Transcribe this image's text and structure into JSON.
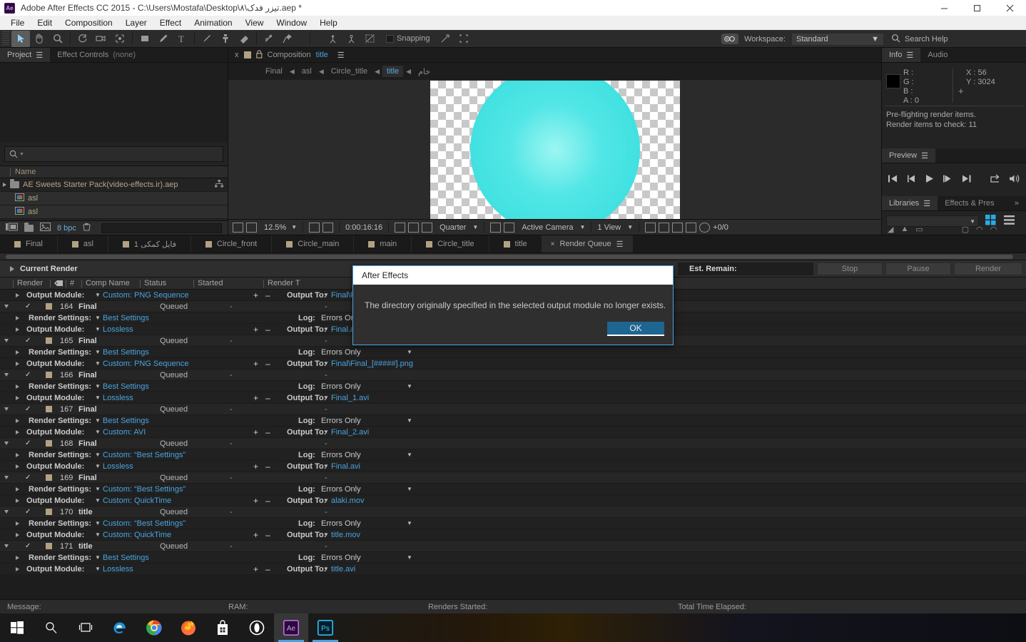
{
  "window": {
    "title": "Adobe After Effects CC 2015 - C:\\Users\\Mostafa\\Desktop\\۸\\تیزر فدک.aep *",
    "app_icon": "Ae",
    "minimize": "minimize-icon",
    "maximize": "maximize-icon",
    "close": "close-icon"
  },
  "menu": [
    "File",
    "Edit",
    "Composition",
    "Layer",
    "Effect",
    "Animation",
    "View",
    "Window",
    "Help"
  ],
  "toolbar": {
    "tools": [
      "selection-tool",
      "hand-tool",
      "zoom-tool",
      "rotation-tool",
      "camera-tool",
      "pan-behind-tool",
      "shape-tool",
      "pen-tool",
      "type-tool",
      "brush-tool",
      "clone-stamp-tool",
      "eraser-tool",
      "roto-brush-tool",
      "puppet-pin-tool"
    ],
    "right_tools": [
      "local-axis-mode",
      "world-axis-mode",
      "view-axis-mode"
    ],
    "snapping_label": "Snapping",
    "snap_tools": [
      "snap-to-feature",
      "align-to-bounds"
    ],
    "workspace_label": "Workspace:",
    "workspace_value": "Standard",
    "search_placeholder": "Search Help"
  },
  "project_panel": {
    "tabs": [
      {
        "label": "Project",
        "active": true,
        "suffix": ""
      },
      {
        "label": "Effect Controls",
        "active": false,
        "suffix": "(none)"
      }
    ],
    "search_placeholder": "",
    "column_header": "Name",
    "rows": [
      {
        "name": "AE Sweets Starter Pack(video-effects.ir).aep",
        "type": "folder",
        "expander": true
      },
      {
        "name": "asl",
        "type": "comp",
        "expander": false
      },
      {
        "name": "asl",
        "type": "comp",
        "expander": false
      }
    ],
    "footer": {
      "bit_depth": "8 bpc",
      "icons": [
        "new-comp-icon",
        "new-folder-icon",
        "new-footage-icon",
        "delete-icon"
      ]
    }
  },
  "comp_panel": {
    "close": "x",
    "label": "Composition",
    "name": "title",
    "lock_icon": "lock-icon",
    "menu_icon": "panel-menu-icon",
    "breadcrumb": [
      {
        "label": "Final",
        "active": false
      },
      {
        "label": "asl",
        "active": false
      },
      {
        "label": "Circle_title",
        "active": false
      },
      {
        "label": "title",
        "active": true
      },
      {
        "label": "خام",
        "active": false
      }
    ],
    "footer": {
      "zoom": "12.5%",
      "time": "0:00:16:16",
      "resolution": "Quarter",
      "camera": "Active Camera",
      "views": "1 View",
      "frame_offset": "+0/0",
      "icons": [
        "toggle-transparency-grid-icon",
        "toggle-viewer-icon",
        "region-of-interest-icon",
        "title-action-safe-icon",
        "take-snapshot-icon",
        "show-snapshot-icon",
        "show-channel-icon",
        "toggle-mask-icon",
        "toggle-transparency-icon",
        "timeline-icon",
        "fast-previews-icon",
        "render-stats-icon",
        "3d-renderer-icon",
        "reset-exposure-icon"
      ]
    }
  },
  "info_panel": {
    "tabs": [
      {
        "label": "Info",
        "active": true
      },
      {
        "label": "Audio",
        "active": false
      }
    ],
    "color": {
      "R": "R :",
      "G": "G :",
      "B": "B :",
      "A": "A : 0"
    },
    "coords": {
      "X": "X : 56",
      "Y": "Y : 3024"
    },
    "message_line1": "Pre-flighting render items.",
    "message_line2": "Render items to check: 11"
  },
  "preview_panel": {
    "tabs": [
      {
        "label": "Preview",
        "active": true
      }
    ],
    "buttons": [
      "first-frame-icon",
      "previous-frame-icon",
      "play-icon",
      "next-frame-icon",
      "last-frame-icon",
      "loop-icon",
      "mute-audio-icon"
    ]
  },
  "libraries_panel": {
    "tabs": [
      {
        "label": "Libraries",
        "active": true
      },
      {
        "label": "Effects & Pres",
        "active": false
      }
    ],
    "overflow": "»",
    "view_icons": [
      "grid-view-icon",
      "list-view-icon"
    ]
  },
  "comp_tabs": [
    {
      "label": "Final",
      "active": false,
      "closable": false
    },
    {
      "label": "asl",
      "active": false,
      "closable": false
    },
    {
      "label": "فایل کمکی 1",
      "active": false,
      "closable": false
    },
    {
      "label": "Circle_front",
      "active": false,
      "closable": false
    },
    {
      "label": "Circle_main",
      "active": false,
      "closable": false
    },
    {
      "label": "main",
      "active": false,
      "closable": false
    },
    {
      "label": "Circle_title",
      "active": false,
      "closable": false
    },
    {
      "label": "title",
      "active": false,
      "closable": false
    },
    {
      "label": "Render Queue",
      "active": true,
      "closable": true
    }
  ],
  "render_queue": {
    "current_render_label": "Current Render",
    "est_remain_label": "Est. Remain:",
    "buttons": [
      {
        "label": "Stop",
        "name": "stop-button"
      },
      {
        "label": "Pause",
        "name": "pause-button"
      },
      {
        "label": "Render",
        "name": "render-button"
      }
    ],
    "columns": [
      "Render",
      "label-icon",
      "#",
      "Comp Name",
      "Status",
      "Started",
      "Render T"
    ],
    "labels": {
      "render_settings": "Render Settings:",
      "output_module": "Output Module:",
      "log": "Log:",
      "output_to": "Output To:"
    },
    "rows": [
      {
        "kind": "output",
        "module": "Custom: PNG Sequence",
        "output_to": "Final\\F"
      },
      {
        "kind": "item",
        "num": "164",
        "comp": "Final",
        "status": "Queued",
        "started": "-",
        "render_time": "-"
      },
      {
        "kind": "settings",
        "settings": "Best Settings",
        "log": "Errors Only"
      },
      {
        "kind": "output",
        "module": "Lossless",
        "output_to": "Final.avi"
      },
      {
        "kind": "item",
        "num": "165",
        "comp": "Final",
        "status": "Queued",
        "started": "-",
        "render_time": "-"
      },
      {
        "kind": "settings",
        "settings": "Best Settings",
        "log": "Errors Only"
      },
      {
        "kind": "output",
        "module": "Custom: PNG Sequence",
        "output_to": "Final\\Final_[#####].png"
      },
      {
        "kind": "item",
        "num": "166",
        "comp": "Final",
        "status": "Queued",
        "started": "-",
        "render_time": "-"
      },
      {
        "kind": "settings",
        "settings": "Best Settings",
        "log": "Errors Only"
      },
      {
        "kind": "output",
        "module": "Lossless",
        "output_to": "Final_1.avi"
      },
      {
        "kind": "item",
        "num": "167",
        "comp": "Final",
        "status": "Queued",
        "started": "-",
        "render_time": "-"
      },
      {
        "kind": "settings",
        "settings": "Best Settings",
        "log": "Errors Only"
      },
      {
        "kind": "output",
        "module": "Custom: AVI",
        "output_to": "Final_2.avi"
      },
      {
        "kind": "item",
        "num": "168",
        "comp": "Final",
        "status": "Queued",
        "started": "-",
        "render_time": "-"
      },
      {
        "kind": "settings",
        "settings": "Custom: “Best Settings”",
        "log": "Errors Only"
      },
      {
        "kind": "output",
        "module": "Lossless",
        "output_to": "Final.avi"
      },
      {
        "kind": "item",
        "num": "169",
        "comp": "Final",
        "status": "Queued",
        "started": "-",
        "render_time": "-"
      },
      {
        "kind": "settings",
        "settings": "Custom: “Best Settings”",
        "log": "Errors Only"
      },
      {
        "kind": "output",
        "module": "Custom: QuickTime",
        "output_to": "alaki.mov"
      },
      {
        "kind": "item",
        "num": "170",
        "comp": "title",
        "status": "Queued",
        "started": "-",
        "render_time": "-"
      },
      {
        "kind": "settings",
        "settings": "Custom: “Best Settings”",
        "log": "Errors Only"
      },
      {
        "kind": "output",
        "module": "Custom: QuickTime",
        "output_to": "title.mov"
      },
      {
        "kind": "item",
        "num": "171",
        "comp": "title",
        "status": "Queued",
        "started": "-",
        "render_time": "-"
      },
      {
        "kind": "settings",
        "settings": "Best Settings",
        "log": "Errors Only"
      },
      {
        "kind": "output",
        "module": "Lossless",
        "output_to": "title.avi"
      }
    ]
  },
  "status_bar": {
    "message": "Message:",
    "ram": "RAM:",
    "renders_started": "Renders Started:",
    "total_time": "Total Time Elapsed:"
  },
  "dialog": {
    "title": "After Effects",
    "message": "The directory originally specified in the selected output module no longer exists.",
    "ok_label": "OK"
  },
  "taskbar": {
    "items": [
      {
        "name": "start-button",
        "icon": "windows-logo-icon"
      },
      {
        "name": "search-taskbar",
        "icon": "search-icon"
      },
      {
        "name": "task-view",
        "icon": "task-view-icon"
      },
      {
        "name": "edge-taskbar",
        "icon": "edge-icon"
      },
      {
        "name": "chrome-taskbar",
        "icon": "chrome-icon"
      },
      {
        "name": "firefox-taskbar",
        "icon": "firefox-icon"
      },
      {
        "name": "store-taskbar",
        "icon": "store-icon"
      },
      {
        "name": "opera-taskbar",
        "icon": "opera-icon"
      },
      {
        "name": "after-effects-taskbar",
        "icon": "after-effects-icon",
        "label": "Ae",
        "active": true
      },
      {
        "name": "photoshop-taskbar",
        "icon": "photoshop-icon",
        "label": "Ps"
      }
    ]
  },
  "colors": {
    "accent_blue": "#4aa3df",
    "comp_circle": "#40e0e0",
    "label_tan": "#b3a184",
    "panel_bg": "#232323"
  }
}
